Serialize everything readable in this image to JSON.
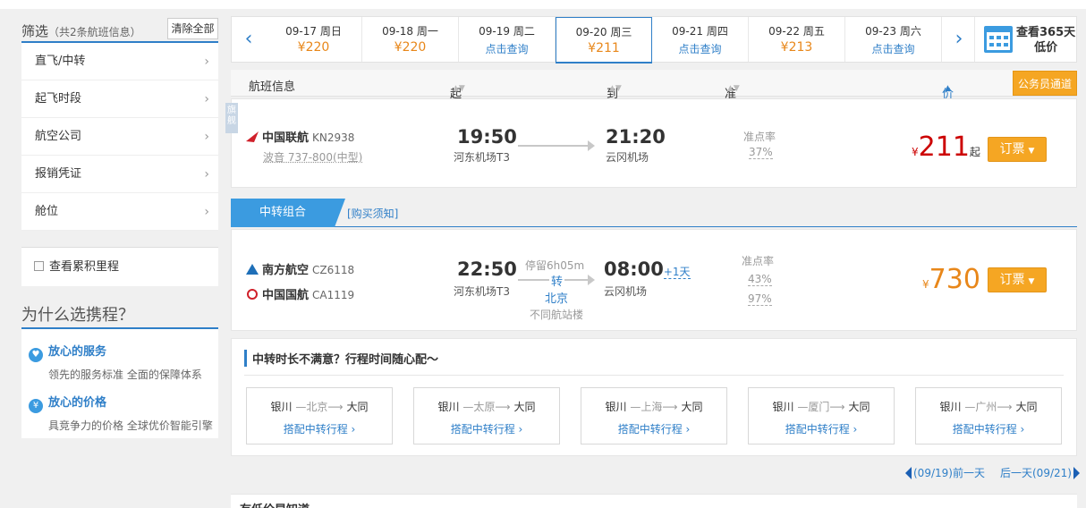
{
  "filter": {
    "title": "筛选",
    "count_text": "（共2条航班信息）",
    "clear_label": "清除全部",
    "items": [
      {
        "label": "直飞/中转"
      },
      {
        "label": "起飞时段"
      },
      {
        "label": "航空公司"
      },
      {
        "label": "报销凭证"
      },
      {
        "label": "舱位"
      }
    ],
    "mileage_label": "查看累积里程"
  },
  "why": {
    "title": "为什么选携程？",
    "items": [
      {
        "icon": "thumb-icon",
        "title": "放心的服务",
        "desc": "领先的服务标准 全面的保障体系"
      },
      {
        "icon": "yen-icon",
        "title": "放心的价格",
        "desc": "具竞争力的价格 全球优价智能引擎"
      }
    ]
  },
  "dates": [
    {
      "date": "09-17 周日",
      "price": "¥220"
    },
    {
      "date": "09-18 周一",
      "price": "¥220"
    },
    {
      "date": "09-19 周二",
      "query": "点击查询"
    },
    {
      "date": "09-20 周三",
      "price": "¥211",
      "active": true
    },
    {
      "date": "09-21 周四",
      "query": "点击查询"
    },
    {
      "date": "09-22 周五",
      "price": "¥213"
    },
    {
      "date": "09-23 周六",
      "query": "点击查询"
    }
  ],
  "calendar": {
    "line1": "查看365天",
    "line2": "低价"
  },
  "columns": {
    "flight_info": "航班信息",
    "depart": "起飞时间",
    "arrive": "到达时间",
    "ontime": "准点率",
    "price": "价格",
    "gov_channel": "公务员通道"
  },
  "flight1": {
    "tag": "旗舰",
    "airline": "中国联航",
    "flight_no": "KN2938",
    "plane": "波音 737-800(中型)",
    "depart_time": "19:50",
    "depart_airport": "河东机场T3",
    "arrive_time": "21:20",
    "arrive_airport": "云冈机场",
    "ontime_label": "准点率",
    "ontime_value": "37%",
    "currency": "¥",
    "price": "211",
    "price_suffix": "起",
    "order_label": "订票"
  },
  "transfer_tabs": {
    "active": "中转组合",
    "link": "[购买须知]"
  },
  "flight2": {
    "airline1": "南方航空",
    "flight_no1": "CZ6118",
    "airline2": "中国国航",
    "flight_no2": "CA1119",
    "depart_time": "22:50",
    "depart_airport": "河东机场T3",
    "stopover": "停留6h05m",
    "transfer_char": "转",
    "transfer_city": "北京",
    "terminal_note": "不同航站楼",
    "arrive_time": "08:00",
    "plus_day": "+1天",
    "arrive_airport": "云冈机场",
    "ontime_label": "准点率",
    "ontime_value1": "43%",
    "ontime_value2": "97%",
    "currency": "¥",
    "price": "730",
    "order_label": "订票"
  },
  "suggestions": {
    "title": "中转时长不满意？行程时间随心配～",
    "routes": [
      {
        "from": "银川",
        "via": "北京",
        "to": "大同",
        "action": "搭配中转行程 ›"
      },
      {
        "from": "银川",
        "via": "太原",
        "to": "大同",
        "action": "搭配中转行程 ›"
      },
      {
        "from": "银川",
        "via": "上海",
        "to": "大同",
        "action": "搭配中转行程 ›"
      },
      {
        "from": "银川",
        "via": "厦门",
        "to": "大同",
        "action": "搭配中转行程 ›"
      },
      {
        "from": "银川",
        "via": "广州",
        "to": "大同",
        "action": "搭配中转行程 ›"
      }
    ]
  },
  "daynav": {
    "prev": "(09/19)前一天",
    "next": "后一天(09/21)"
  },
  "low_price": "有低价早知道"
}
